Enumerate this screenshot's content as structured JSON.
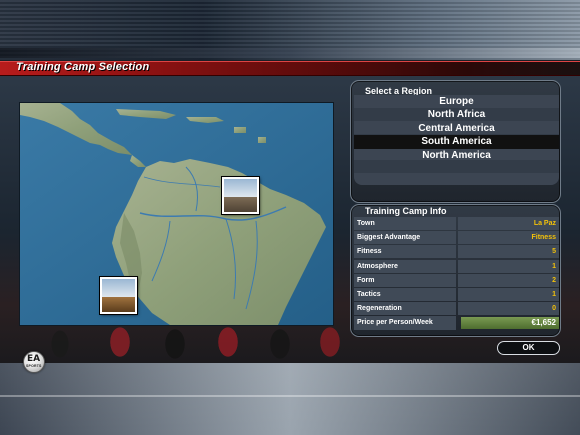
{
  "header": {
    "title": "Training Camp Selection"
  },
  "regions": {
    "title": "Select a Region",
    "items": [
      "Europe",
      "North Africa",
      "Central America",
      "South America",
      "North America"
    ],
    "selected": "South America"
  },
  "camp_info": {
    "title": "Training Camp Info",
    "rows": [
      {
        "label": "Town",
        "value": "La Paz"
      },
      {
        "label": "Biggest Advantage",
        "value": "Fitness"
      },
      {
        "label": "Fitness",
        "value": "5"
      },
      {
        "label": "Atmosphere",
        "value": "1"
      },
      {
        "label": "Form",
        "value": "2"
      },
      {
        "label": "Tactics",
        "value": "1"
      },
      {
        "label": "Regeneration",
        "value": "0"
      }
    ],
    "price": {
      "label": "Price per Person/Week",
      "value": "€1,652"
    }
  },
  "buttons": {
    "ok": "OK"
  },
  "logo": {
    "brand": "EA",
    "sub": "SPORTS"
  },
  "colors": {
    "accent_red": "#b71c1c",
    "value_gold": "#f2c10a",
    "price_green": "#6b8b45",
    "ocean": "#2e6a95",
    "land": "#8fa07a"
  }
}
